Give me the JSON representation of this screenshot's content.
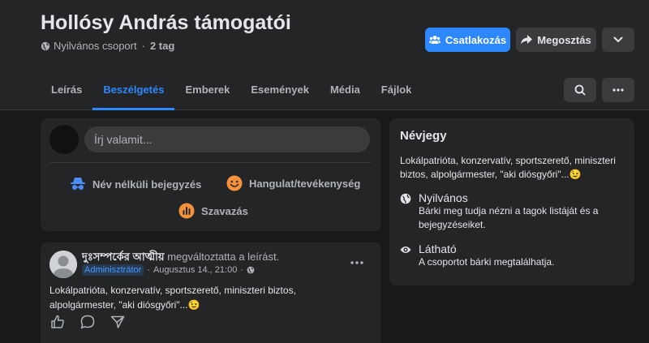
{
  "group": {
    "title": "Hollósy András támogatói",
    "privacy": "Nyilvános csoport",
    "separator": "·",
    "members": "2 tag"
  },
  "header_buttons": {
    "join": "Csatlakozás",
    "share": "Megosztás"
  },
  "tabs": [
    "Leírás",
    "Beszélgetés",
    "Emberek",
    "Események",
    "Média",
    "Fájlok"
  ],
  "active_tab": "Beszélgetés",
  "composer": {
    "placeholder": "Írj valamit...",
    "anonymous": "Név nélküli bejegyzés",
    "feeling": "Hangulat/tevékenység",
    "poll": "Szavazás"
  },
  "about": {
    "title": "Névjegy",
    "description": "Lokálpatrióta, konzervatív, sportszerető, miniszteri biztos, alpolgármester, \"aki diósgyőri\"...😉",
    "public_title": "Nyilvános",
    "public_desc": "Bárki meg tudja nézni a tagok listáját és a bejegyzéseiket.",
    "visible_title": "Látható",
    "visible_desc": "A csoportot bárki megtalálhatja."
  },
  "post": {
    "author": "দুঃসম্পর্কের আত্মীয়",
    "action": "megváltoztatta a leírást.",
    "badge": "Adminisztrátor",
    "separator": "·",
    "timestamp": "Augusztus 14., 21:00",
    "text": "Lokálpatrióta, konzervatív, sportszerető, miniszteri biztos, alpolgármester, \"aki diósgyőri\"...😉"
  },
  "colors": {
    "accent": "#2d88ff",
    "background": "#18191a",
    "surface": "#242526"
  },
  "icons": {
    "join": "group-icon",
    "share": "share-arrow-icon",
    "more": "chevron-down-icon",
    "search": "search-icon",
    "menu": "more-dots-icon",
    "globe": "globe-icon",
    "eye": "eye-icon",
    "anonymous": "incognito-icon",
    "feeling": "smile-icon",
    "poll": "poll-icon",
    "like": "like-icon",
    "comment": "comment-icon",
    "send": "send-icon"
  }
}
